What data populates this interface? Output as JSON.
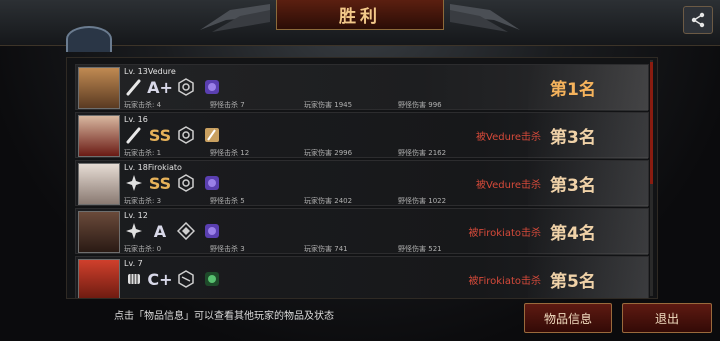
{
  "header": {
    "title": "胜利"
  },
  "hint": "点击「物品信息」可以查看其他玩家的物品及状态",
  "buttons": {
    "item_info": "物品信息",
    "exit": "退出"
  },
  "labels": {
    "player_kills": "玩家击杀",
    "monster_kills": "野怪击杀",
    "player_damage": "玩家伤害",
    "monster_damage": "野怪伤害"
  },
  "players": [
    {
      "level": "Lv. 13",
      "name": "Vedure",
      "grade": "A+",
      "player_kills": "4",
      "monster_kills": "7",
      "player_damage": "1945",
      "monster_damage": "996",
      "killed_by": "",
      "rank": "第1名",
      "avatar_color": "#8a5a3a"
    },
    {
      "level": "Lv. 16",
      "name": "",
      "grade": "SS",
      "player_kills": "1",
      "monster_kills": "12",
      "player_damage": "2996",
      "monster_damage": "2162",
      "killed_by": "被Vedure击杀",
      "rank": "第3名",
      "avatar_color": "#7a2a22"
    },
    {
      "level": "Lv. 18",
      "name": "Firokiato",
      "grade": "SS",
      "player_kills": "3",
      "monster_kills": "5",
      "player_damage": "2402",
      "monster_damage": "1022",
      "killed_by": "被Vedure击杀",
      "rank": "第3名",
      "avatar_color": "#b8a8a0"
    },
    {
      "level": "Lv. 12",
      "name": "",
      "grade": "A",
      "player_kills": "0",
      "monster_kills": "3",
      "player_damage": "741",
      "monster_damage": "521",
      "killed_by": "被Firokiato击杀",
      "rank": "第4名",
      "avatar_color": "#5a3a2a"
    },
    {
      "level": "Lv. 7",
      "name": "",
      "grade": "C+",
      "player_kills": "",
      "monster_kills": "",
      "player_damage": "",
      "monster_damage": "",
      "killed_by": "被Firokiato击杀",
      "rank": "第5名",
      "avatar_color": "#b03a2a"
    }
  ]
}
